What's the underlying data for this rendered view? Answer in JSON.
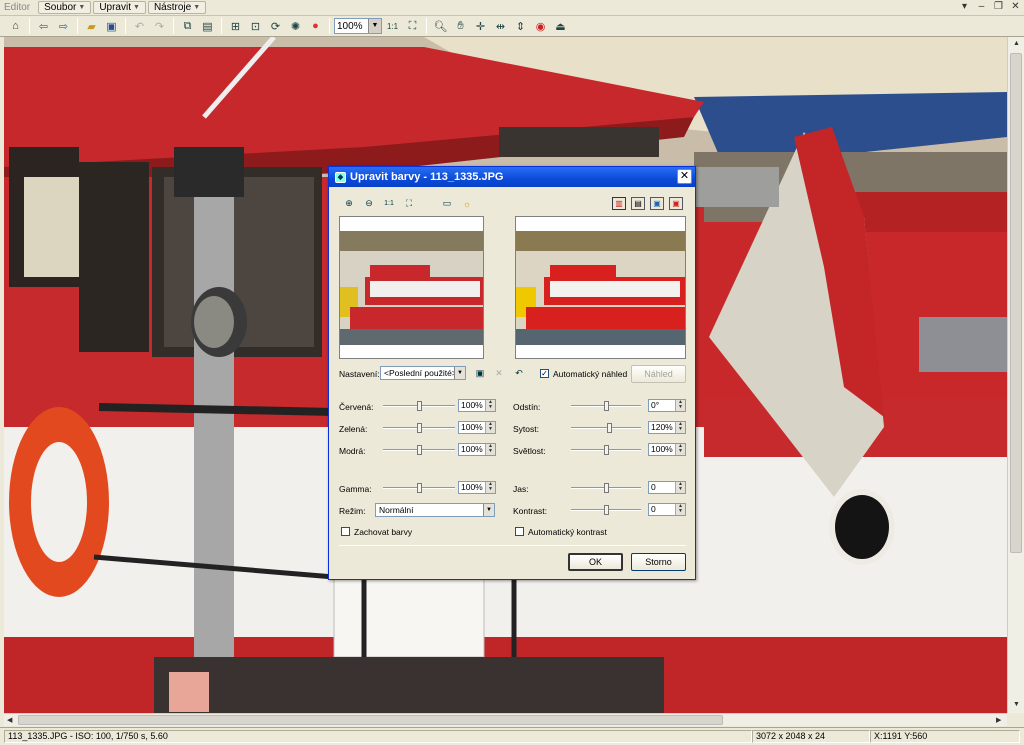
{
  "app": {
    "name": "Editor",
    "menus": [
      "Soubor",
      "Upravit",
      "Nástroje"
    ]
  },
  "toolbar": {
    "zoom": "100%"
  },
  "dialog": {
    "title": "Upravit barvy - 113_1335.JPG",
    "settings_label": "Nastavení:",
    "settings_value": "<Poslední použité>",
    "auto_preview_label": "Automatický náhled",
    "auto_preview_checked": true,
    "preview_button": "Náhled",
    "left": [
      {
        "label": "Červená:",
        "value": "100%",
        "level": 0.5
      },
      {
        "label": "Zelená:",
        "value": "100%",
        "level": 0.5
      },
      {
        "label": "Modrá:",
        "value": "100%",
        "level": 0.5
      }
    ],
    "right": [
      {
        "label": "Odstín:",
        "value": "0°",
        "level": 0.5
      },
      {
        "label": "Sytost:",
        "value": "120%",
        "level": 0.55
      },
      {
        "label": "Světlost:",
        "value": "100%",
        "level": 0.5
      }
    ],
    "gamma": {
      "label": "Gamma:",
      "value": "100%",
      "level": 0.5
    },
    "brightness": {
      "label": "Jas:",
      "value": "0",
      "level": 0.5
    },
    "contrast": {
      "label": "Kontrast:",
      "value": "0",
      "level": 0.5
    },
    "mode_label": "Režim:",
    "mode_value": "Normální",
    "keep_colors_label": "Zachovat barvy",
    "keep_colors_checked": false,
    "auto_contrast_label": "Automatický kontrast",
    "auto_contrast_checked": false,
    "ok_label": "OK",
    "cancel_label": "Storno"
  },
  "status": {
    "file_info": "113_1335.JPG - ISO: 100, 1/750 s, 5.60",
    "dimensions": "3072 x 2048 x 24",
    "coords": "X:1191  Y:560"
  }
}
